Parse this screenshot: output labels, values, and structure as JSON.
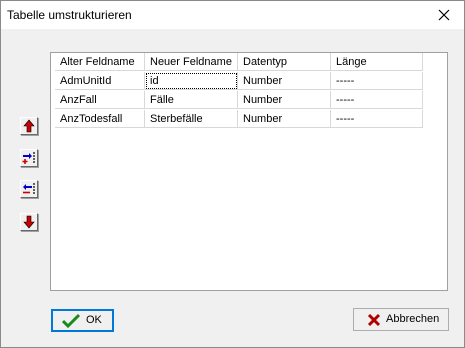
{
  "window": {
    "title": "Tabelle umstrukturieren"
  },
  "grid": {
    "columns": [
      "Alter Feldname",
      "Neuer Feldname",
      "Datentyp",
      "Länge"
    ],
    "rows": [
      [
        "AdmUnitId",
        "id",
        "Number",
        "-----"
      ],
      [
        "AnzFall",
        "Fälle",
        "Number",
        "-----"
      ],
      [
        "AnzTodesfall",
        "Sterbefälle",
        "Number",
        "-----"
      ]
    ]
  },
  "buttons": {
    "ok_label": "OK",
    "cancel_label": "Abbrechen"
  },
  "icons": {
    "move_up": "arrow-up-icon",
    "add_field": "add-field-icon",
    "remove_field": "remove-field-icon",
    "move_down": "arrow-down-icon",
    "ok": "checkmark-icon",
    "cancel": "x-icon",
    "close": "close-icon"
  },
  "colors": {
    "arrow_red": "#cc0000",
    "add_blue": "#0000cc",
    "check_green": "#1a8a1a",
    "cancel_red": "#b00000"
  }
}
